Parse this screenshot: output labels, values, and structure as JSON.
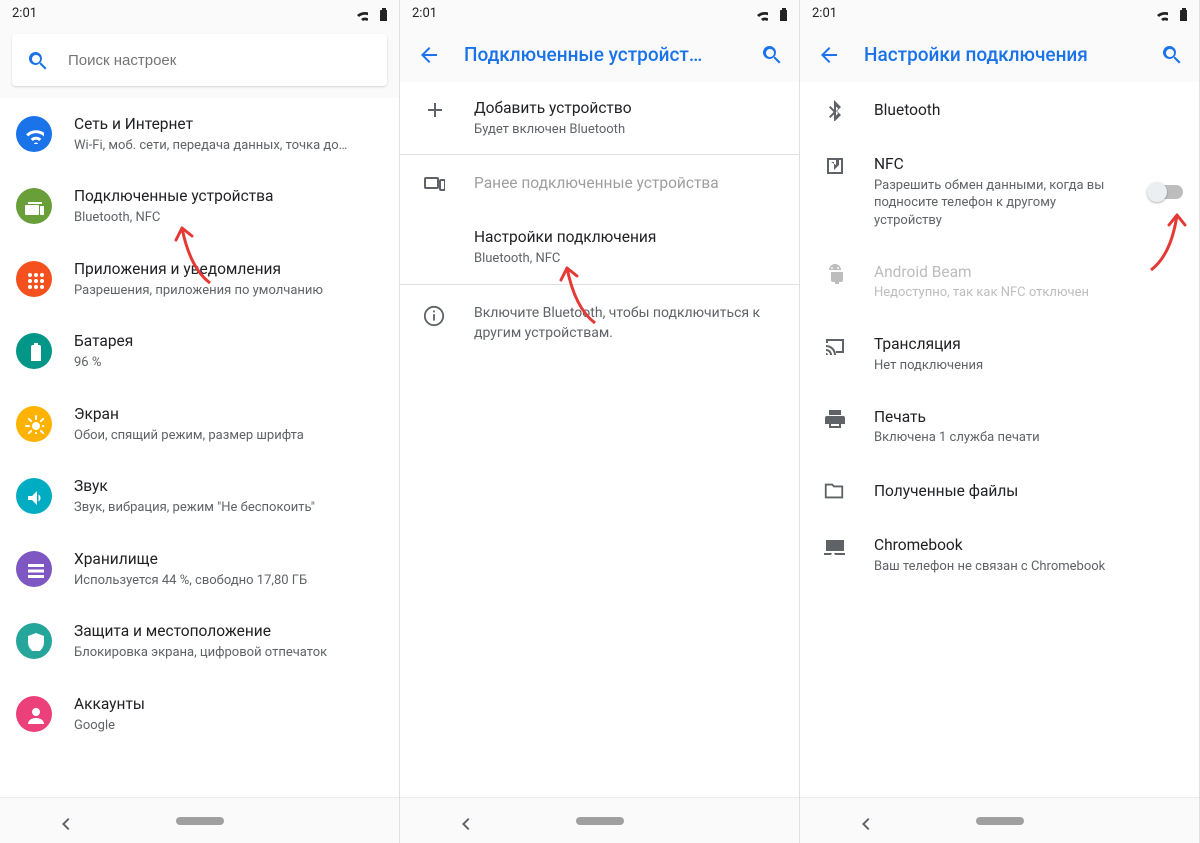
{
  "status": {
    "time": "2:01"
  },
  "pane1": {
    "search_placeholder": "Поиск настроек",
    "items": [
      {
        "title": "Сеть и Интернет",
        "sub": "Wi-Fi, моб. сети, передача данных, точка до…",
        "color": "#1a73e8",
        "icon": "wifi"
      },
      {
        "title": "Подключенные устройства",
        "sub": "Bluetooth, NFC",
        "color": "#689f38",
        "icon": "devices"
      },
      {
        "title": "Приложения и уведомления",
        "sub": "Разрешения, приложения по умолчанию",
        "color": "#f4511e",
        "icon": "apps"
      },
      {
        "title": "Батарея",
        "sub": "96 %",
        "color": "#009688",
        "icon": "battery"
      },
      {
        "title": "Экран",
        "sub": "Обои, спящий режим, размер шрифта",
        "color": "#ffb300",
        "icon": "brightness"
      },
      {
        "title": "Звук",
        "sub": "Звук, вибрация, режим \"Не беспокоить\"",
        "color": "#00acc1",
        "icon": "sound"
      },
      {
        "title": "Хранилище",
        "sub": "Используется 44 %, свободно 17,80 ГБ",
        "color": "#7e57c2",
        "icon": "storage"
      },
      {
        "title": "Защита и местоположение",
        "sub": "Блокировка экрана, цифровой отпечаток",
        "color": "#26a69a",
        "icon": "security"
      },
      {
        "title": "Аккаунты",
        "sub": "Google",
        "color": "#ec407a",
        "icon": "account"
      }
    ]
  },
  "pane2": {
    "title": "Подключенные устройст…",
    "pair": {
      "title": "Добавить устройство",
      "sub": "Будет включен Bluetooth"
    },
    "previous_label": "Ранее подключенные устройства",
    "prefs": {
      "title": "Настройки подключения",
      "sub": "Bluetooth, NFC"
    },
    "info": "Включите Bluetooth, чтобы подключиться к другим устройствам."
  },
  "pane3": {
    "title": "Настройки подключения",
    "items": [
      {
        "title": "Bluetooth",
        "sub": "",
        "icon": "bluetooth",
        "toggle": false,
        "disabled": false
      },
      {
        "title": "NFC",
        "sub": "Разрешить обмен данными, когда вы подносите телефон к другому устройству",
        "icon": "nfc",
        "toggle": true,
        "disabled": false
      },
      {
        "title": "Android Beam",
        "sub": "Недоступно, так как NFC отключен",
        "icon": "android",
        "toggle": false,
        "disabled": true
      },
      {
        "title": "Трансляция",
        "sub": "Нет подключения",
        "icon": "cast",
        "toggle": false,
        "disabled": false
      },
      {
        "title": "Печать",
        "sub": "Включена 1 служба печати",
        "icon": "print",
        "toggle": false,
        "disabled": false
      },
      {
        "title": "Полученные файлы",
        "sub": "",
        "icon": "folder",
        "toggle": false,
        "disabled": false
      },
      {
        "title": "Chromebook",
        "sub": "Ваш телефон не связан с Chromebook",
        "icon": "chromebook",
        "toggle": false,
        "disabled": false
      }
    ]
  }
}
